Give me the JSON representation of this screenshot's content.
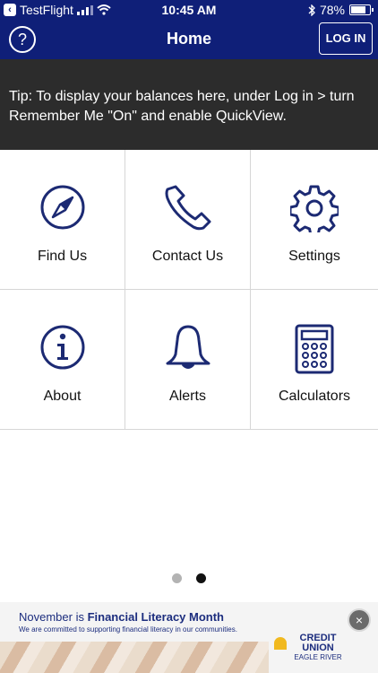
{
  "status_bar": {
    "back_app": "TestFlight",
    "time": "10:45 AM",
    "battery": "78%",
    "battery_level": 0.78
  },
  "nav": {
    "help_symbol": "?",
    "title": "Home",
    "login_label": "LOG IN"
  },
  "tip": {
    "text": "Tip: To display your balances here, under Log in > turn Remember Me \"On\" and enable QuickView."
  },
  "tiles": [
    {
      "label": "Find Us",
      "icon": "compass-icon"
    },
    {
      "label": "Contact Us",
      "icon": "phone-icon"
    },
    {
      "label": "Settings",
      "icon": "gear-icon"
    },
    {
      "label": "About",
      "icon": "info-icon"
    },
    {
      "label": "Alerts",
      "icon": "bell-icon"
    },
    {
      "label": "Calculators",
      "icon": "calculator-icon"
    }
  ],
  "pager": {
    "pages": 2,
    "active": 1
  },
  "banner": {
    "title_prefix": "November is ",
    "title_bold": "Financial Literacy Month",
    "subtitle": "We are committed to supporting financial literacy in our communities.",
    "logo_line1": "CREDIT",
    "logo_line2": "UNION",
    "logo_line3": "EAGLE RIVER",
    "close_symbol": "×"
  },
  "colors": {
    "brand": "#0f1f78",
    "tip_bg": "#2c2c2c",
    "icon": "#1c2a73",
    "dot_active": "#111111",
    "dot_inactive": "#b3b3b3"
  }
}
